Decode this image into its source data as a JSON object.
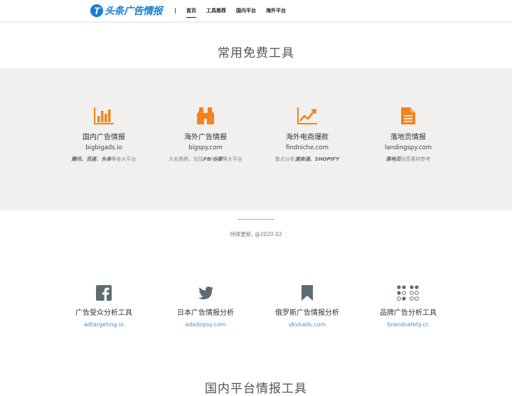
{
  "header": {
    "logo_mark": "T",
    "logo_text": "头条广告情报",
    "nav": [
      {
        "label": "首页",
        "active": true
      },
      {
        "label": "工具推荐",
        "active": false
      },
      {
        "label": "国内平台",
        "active": false
      },
      {
        "label": "海外平台",
        "active": false
      }
    ]
  },
  "section1": {
    "title": "常用免费工具",
    "tools": [
      {
        "icon": "bar-chart-icon",
        "name": "国内广告情报",
        "domain": "bigbigads.io",
        "desc_bold": "腾讯、百度、头条",
        "desc_rest": "等各大平台"
      },
      {
        "icon": "binoculars-icon",
        "name": "海外广告情报",
        "domain": "bigspy.com",
        "desc_pre": "大名鼎鼎，包括",
        "desc_bold": "FB/谷歌",
        "desc_rest": "等大平台"
      },
      {
        "icon": "trend-chart-icon",
        "name": "海外电商爆款",
        "domain": "findniche.com",
        "desc_pre": "重点分析",
        "desc_bold": "速卖通、SHOPIFY",
        "desc_rest": ""
      },
      {
        "icon": "document-icon",
        "name": "落地页情报",
        "domain": "landingspy.com",
        "desc_bold": "落地页",
        "desc_rest": "创意素材参考"
      }
    ],
    "update_note": "持续更新, @2020.02"
  },
  "section2": {
    "tools": [
      {
        "icon": "facebook-icon",
        "name": "广告受众分析工具",
        "link": "adtargeting.io"
      },
      {
        "icon": "twitter-icon",
        "name": "日本广告情报分析",
        "link": "adadopsy.com"
      },
      {
        "icon": "bookmark-icon",
        "name": "俄罗斯广告情报分析",
        "link": "vkvkads.com"
      },
      {
        "icon": "dots-grid-icon",
        "name": "品牌广告分析工具",
        "link": "brandsafety.cc"
      }
    ]
  },
  "section3": {
    "title": "国内平台情报工具"
  },
  "colors": {
    "accent_orange": "#f5821f",
    "icon_gray": "#5f6b73",
    "link_blue": "#4a8fd0",
    "brand_blue": "#1a7fd4",
    "band_gray": "#f1f0ee"
  }
}
